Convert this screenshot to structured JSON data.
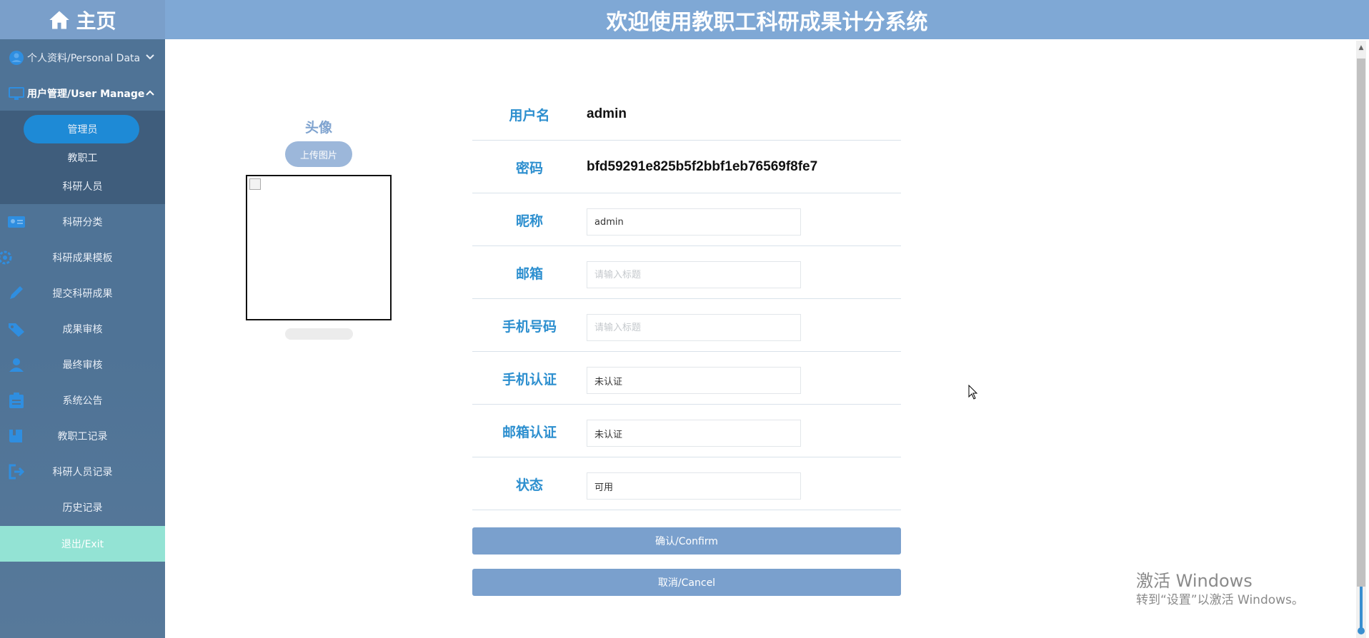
{
  "brand": {
    "title": "主页"
  },
  "header": {
    "title": "欢迎使用教职工科研成果计分系统"
  },
  "sidebar": {
    "groups": [
      {
        "label": "个人资料/Personal Data",
        "icon": "user-circle-icon",
        "expanded": false
      },
      {
        "label": "用户管理/User Manage",
        "icon": "monitor-icon",
        "expanded": true
      }
    ],
    "subitems": [
      {
        "label": "管理员",
        "active": true
      },
      {
        "label": "教职工",
        "active": false
      },
      {
        "label": "科研人员",
        "active": false
      }
    ],
    "items": [
      {
        "label": "科研分类",
        "icon": "id-card-icon"
      },
      {
        "label": "科研成果模板",
        "icon": "gear-icon"
      },
      {
        "label": "提交科研成果",
        "icon": "pencil-icon"
      },
      {
        "label": "成果审核",
        "icon": "tag-icon"
      },
      {
        "label": "最终审核",
        "icon": "people-icon"
      },
      {
        "label": "系统公告",
        "icon": "clipboard-icon"
      },
      {
        "label": "教职工记录",
        "icon": "book-icon"
      },
      {
        "label": "科研人员记录",
        "icon": "logout-icon"
      },
      {
        "label": "历史记录",
        "icon": ""
      }
    ],
    "exit_label": "退出/Exit"
  },
  "avatar": {
    "label": "头像",
    "upload_label": "上传图片"
  },
  "form": {
    "username": {
      "label": "用户名",
      "value": "admin"
    },
    "password": {
      "label": "密码",
      "value": "bfd59291e825b5f2bbf1eb76569f8fe7"
    },
    "nickname": {
      "label": "昵称",
      "value": "admin"
    },
    "email": {
      "label": "邮箱",
      "value": "",
      "placeholder": "请输入标题"
    },
    "phone": {
      "label": "手机号码",
      "value": "",
      "placeholder": "请输入标题"
    },
    "phone_verify": {
      "label": "手机认证",
      "value": "未认证"
    },
    "email_verify": {
      "label": "邮箱认证",
      "value": "未认证"
    },
    "status": {
      "label": "状态",
      "value": "可用"
    }
  },
  "actions": {
    "confirm_label": "确认/Confirm",
    "cancel_label": "取消/Cancel"
  },
  "watermark": {
    "line1": "激活 Windows",
    "line2": "转到“设置”以激活 Windows。"
  },
  "colors": {
    "header": "#7fa8d5",
    "sidebar": "#4f7396",
    "active": "#1e8ad6",
    "exit": "#93e3d4",
    "label": "#2d8fcf",
    "button": "#7aa0cd"
  }
}
